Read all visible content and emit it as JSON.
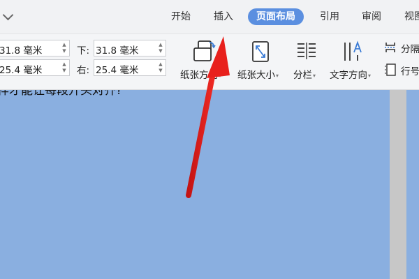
{
  "tabs": [
    {
      "label": "开始"
    },
    {
      "label": "插入"
    },
    {
      "label": "页面布局",
      "active": true
    },
    {
      "label": "引用"
    },
    {
      "label": "审阅"
    },
    {
      "label": "视图"
    }
  ],
  "margins": {
    "top_value": "31.8 毫米",
    "left_value": "25.4 毫米",
    "bottom_label": "下:",
    "bottom_value": "31.8 毫米",
    "right_label": "右:",
    "right_value": "25.4 毫米"
  },
  "ribbon": {
    "orientation_label": "纸张方向",
    "size_label": "纸张大小",
    "columns_label": "分栏",
    "text_direction_label": "文字方向",
    "page_break_label": "分隔符",
    "line_number_label": "行号"
  },
  "document": {
    "text_line": "样才能让每段开头对齐?"
  },
  "colors": {
    "accent_tab": "#5b8fe0",
    "document_bg": "#8aafe0",
    "annotation_arrow": "#e8201c"
  },
  "icons": [
    "chevron-down-icon",
    "paper-orientation-icon",
    "paper-size-icon",
    "columns-icon",
    "text-direction-icon",
    "page-break-icon",
    "line-number-icon"
  ]
}
